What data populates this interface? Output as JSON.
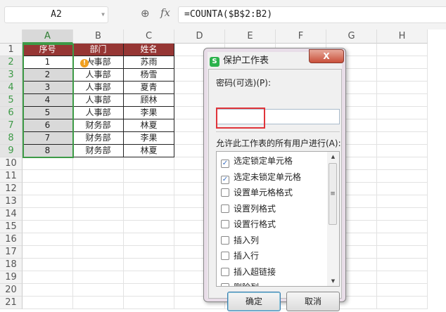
{
  "toolbar": {
    "name_box": "A2",
    "formula": "=COUNTA($B$2:B2)",
    "fx_label": "fx"
  },
  "columns": [
    "A",
    "B",
    "C",
    "D",
    "E",
    "F",
    "G",
    "H"
  ],
  "rows": [
    "1",
    "2",
    "3",
    "4",
    "5",
    "6",
    "7",
    "8",
    "9",
    "10",
    "11",
    "12",
    "13",
    "14",
    "15",
    "16",
    "17",
    "18",
    "19",
    "20",
    "21"
  ],
  "table": {
    "headers": [
      "序号",
      "部门",
      "姓名"
    ],
    "data": [
      [
        "1",
        "人事部",
        "苏雨"
      ],
      [
        "2",
        "人事部",
        "杨雪"
      ],
      [
        "3",
        "人事部",
        "夏青"
      ],
      [
        "4",
        "人事部",
        "顾林"
      ],
      [
        "5",
        "人事部",
        "李果"
      ],
      [
        "6",
        "财务部",
        "林夏"
      ],
      [
        "7",
        "财务部",
        "李果"
      ],
      [
        "8",
        "财务部",
        "林夏"
      ]
    ]
  },
  "dialog": {
    "title": "保护工作表",
    "close": "X",
    "password_label": "密码(可选)(P):",
    "password_value": "",
    "allow_label": "允许此工作表的所有用户进行(A):",
    "options": [
      {
        "label": "选定锁定单元格",
        "checked": true
      },
      {
        "label": "选定未锁定单元格",
        "checked": true
      },
      {
        "label": "设置单元格格式",
        "checked": false
      },
      {
        "label": "设置列格式",
        "checked": false
      },
      {
        "label": "设置行格式",
        "checked": false
      },
      {
        "label": "插入列",
        "checked": false
      },
      {
        "label": "插入行",
        "checked": false
      },
      {
        "label": "插入超链接",
        "checked": false
      },
      {
        "label": "删除列",
        "checked": false
      }
    ],
    "ok": "确定",
    "cancel": "取消"
  },
  "colors": {
    "header_bg": "#963634",
    "selection": "#3d9a46"
  }
}
